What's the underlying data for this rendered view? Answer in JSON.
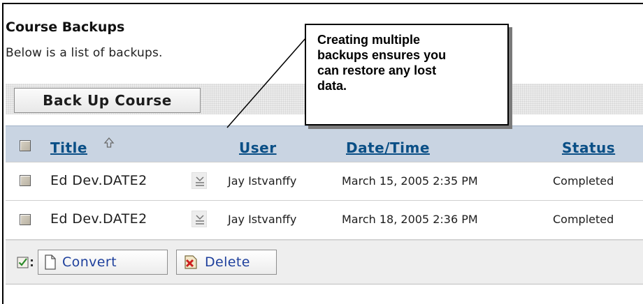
{
  "page": {
    "title": "Course Backups",
    "subtitle": "Below is a list of backups."
  },
  "toolbar": {
    "backup_button_label": "Back Up Course"
  },
  "callout": {
    "lines": [
      "Creating multiple",
      "backups ensures you",
      "can restore any lost",
      "data."
    ]
  },
  "table": {
    "headers": {
      "title": "Title",
      "user": "User",
      "datetime": "Date/Time",
      "status": "Status"
    },
    "sort_icon": "sort-ascending-icon",
    "rows": [
      {
        "title": "Ed Dev.DATE2",
        "user": "Jay Istvanffy",
        "datetime": "March 15, 2005 2:35 PM",
        "status": "Completed"
      },
      {
        "title": "Ed Dev.DATE2",
        "user": "Jay Istvanffy",
        "datetime": "March 18, 2005 2:36 PM",
        "status": "Completed"
      }
    ]
  },
  "actions": {
    "convert_label": "Convert",
    "delete_label": "Delete",
    "convert_icon": "document-icon",
    "delete_icon": "delete-x-icon"
  },
  "colors": {
    "header_bg": "#c9d4e2",
    "link": "#0a4f86",
    "action_text": "#1d3f9c"
  }
}
